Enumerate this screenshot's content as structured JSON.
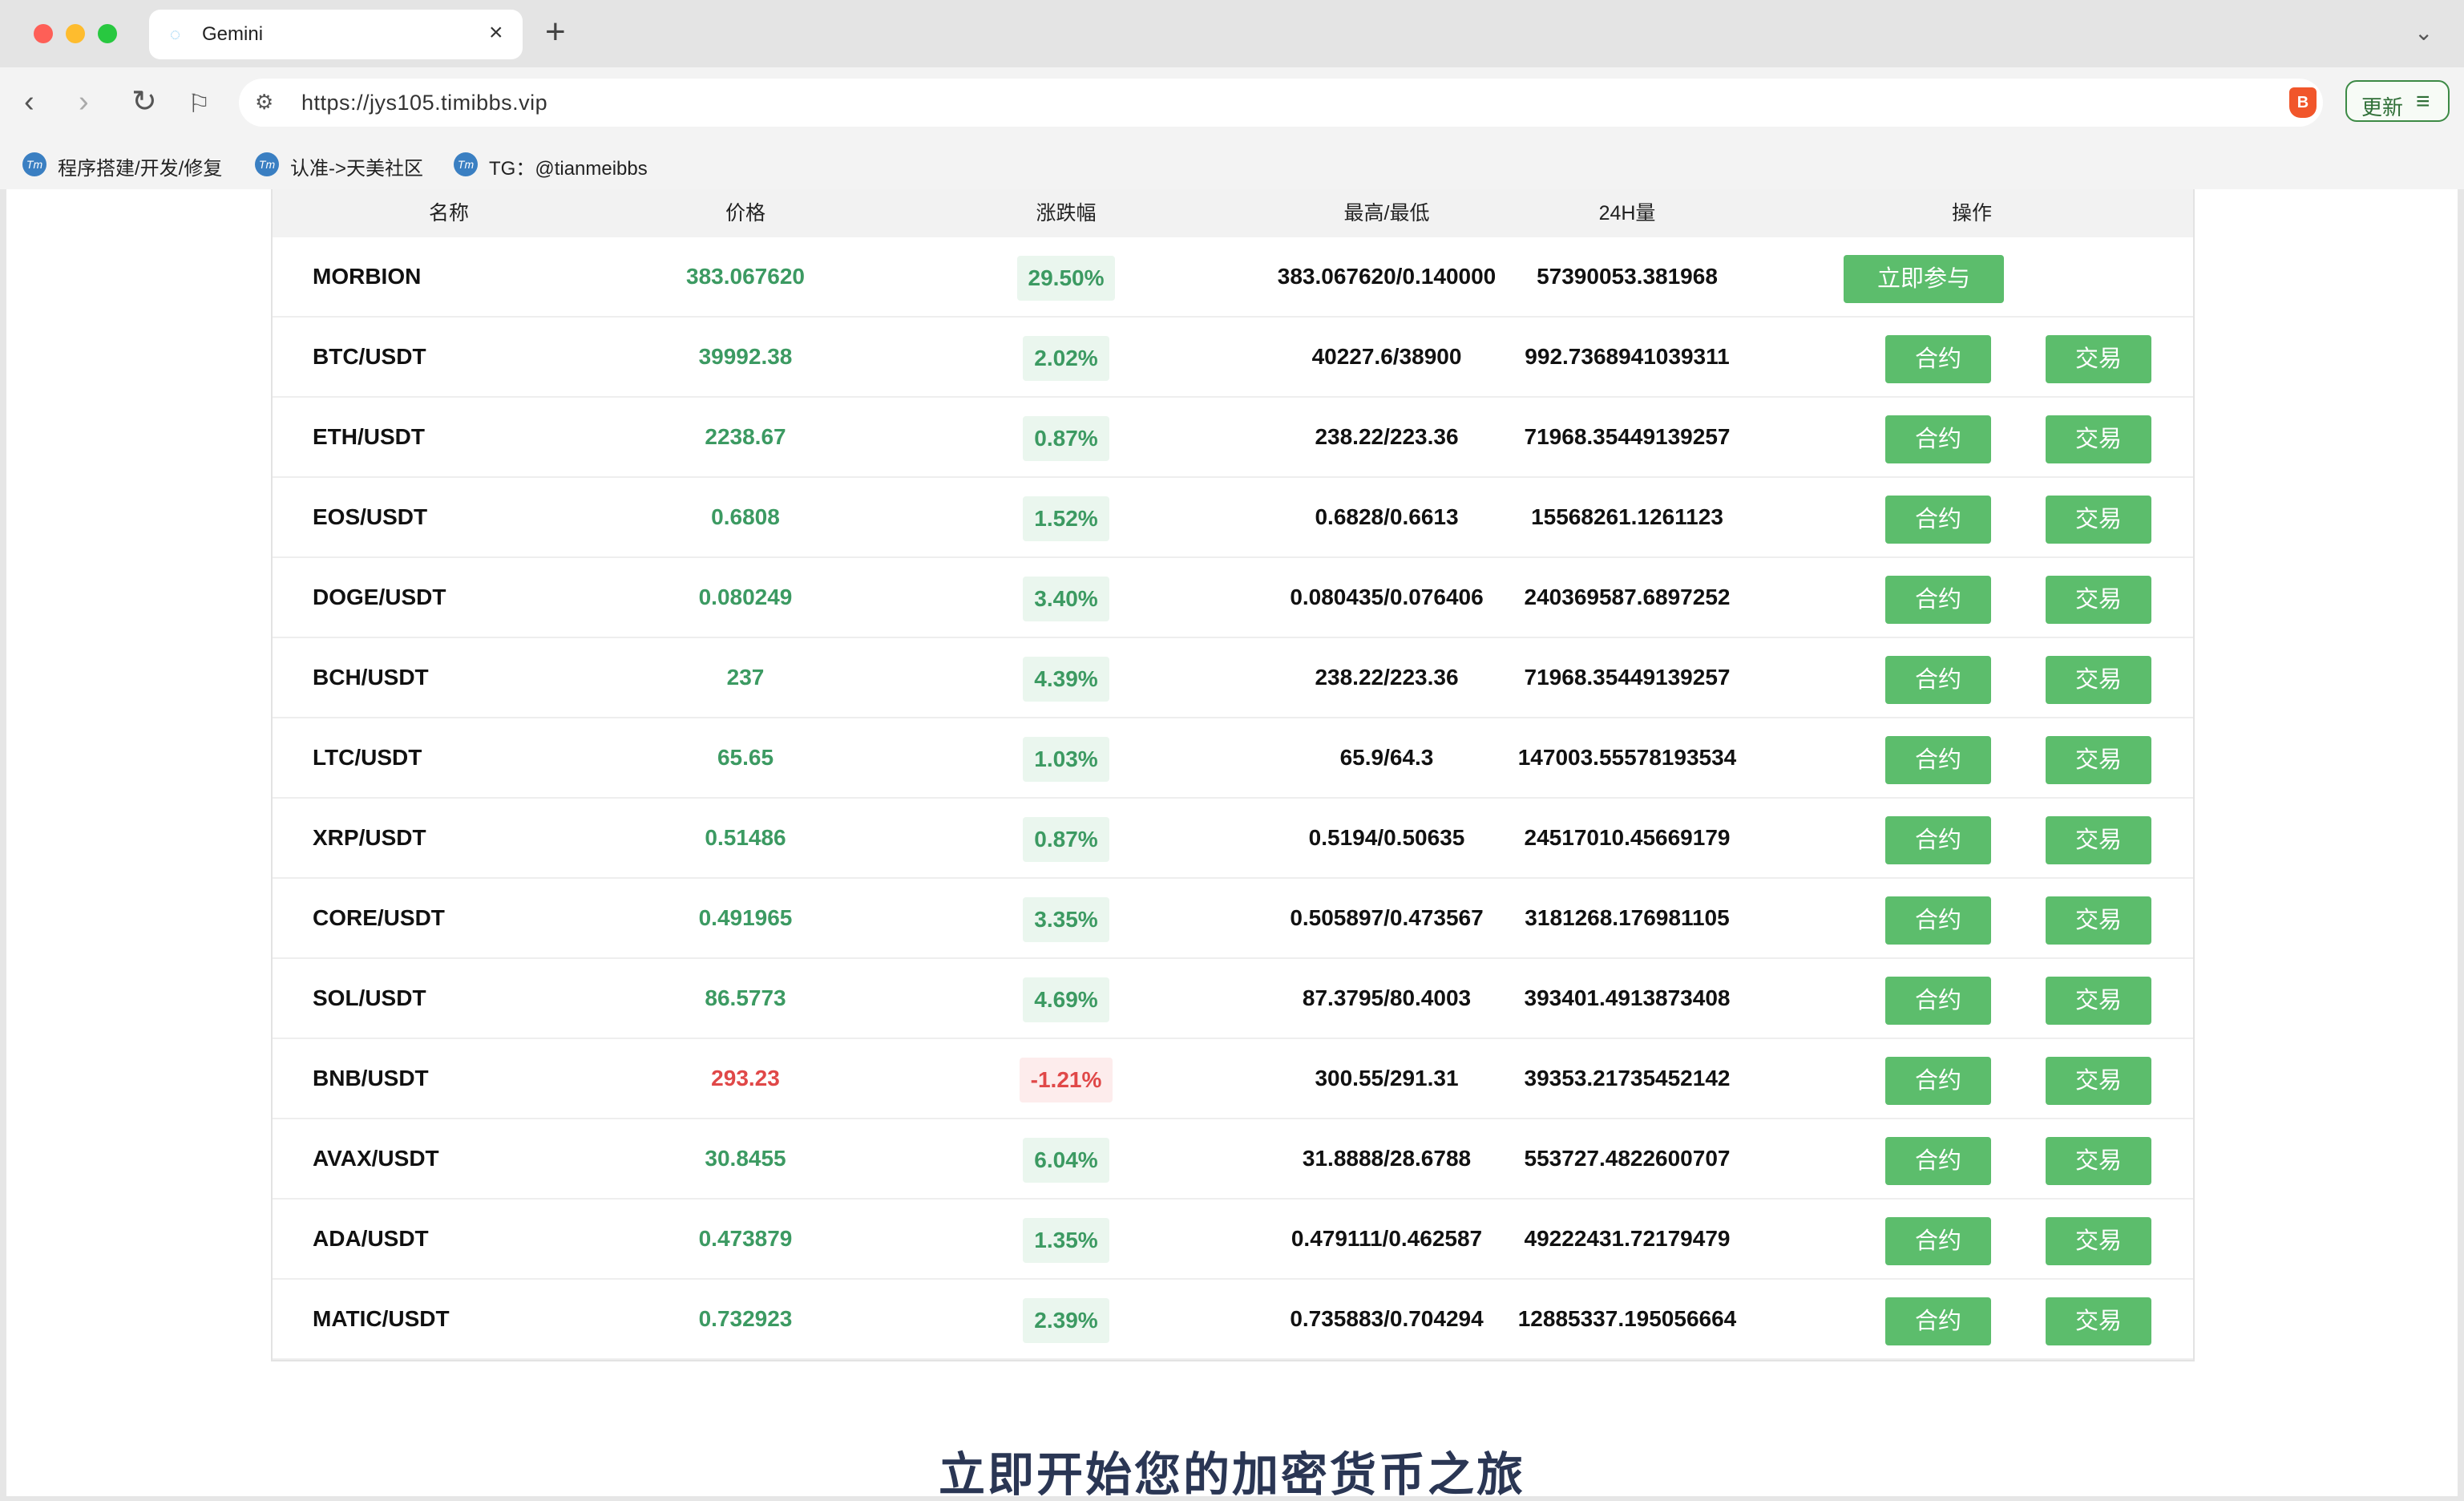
{
  "browser": {
    "tab_title": "Gemini",
    "url": "https://jys105.timibbs.vip",
    "update_label": "更新",
    "bookmarks": [
      {
        "label": "程序搭建/开发/修复"
      },
      {
        "label": "认准->天美社区"
      },
      {
        "label": "TG：@tianmeibbs"
      }
    ]
  },
  "table": {
    "headers": {
      "name": "名称",
      "price": "价格",
      "change": "涨跌幅",
      "highlow": "最高/最低",
      "volume": "24H量",
      "action": "操作"
    },
    "contract_label": "合约",
    "trade_label": "交易",
    "join_label": "立即参与",
    "rows": [
      {
        "name": "MORBION",
        "price": "383.067620",
        "change": "29.50%",
        "highlow": "383.067620/0.140000",
        "volume": "57390053.381968",
        "direction": "up"
      },
      {
        "name": "BTC/USDT",
        "price": "39992.38",
        "change": "2.02%",
        "highlow": "40227.6/38900",
        "volume": "992.7368941039311",
        "direction": "up"
      },
      {
        "name": "ETH/USDT",
        "price": "2238.67",
        "change": "0.87%",
        "highlow": "238.22/223.36",
        "volume": "71968.35449139257",
        "direction": "up"
      },
      {
        "name": "EOS/USDT",
        "price": "0.6808",
        "change": "1.52%",
        "highlow": "0.6828/0.6613",
        "volume": "15568261.1261123",
        "direction": "up"
      },
      {
        "name": "DOGE/USDT",
        "price": "0.080249",
        "change": "3.40%",
        "highlow": "0.080435/0.076406",
        "volume": "240369587.6897252",
        "direction": "up"
      },
      {
        "name": "BCH/USDT",
        "price": "237",
        "change": "4.39%",
        "highlow": "238.22/223.36",
        "volume": "71968.35449139257",
        "direction": "up"
      },
      {
        "name": "LTC/USDT",
        "price": "65.65",
        "change": "1.03%",
        "highlow": "65.9/64.3",
        "volume": "147003.55578193534",
        "direction": "up"
      },
      {
        "name": "XRP/USDT",
        "price": "0.51486",
        "change": "0.87%",
        "highlow": "0.5194/0.50635",
        "volume": "24517010.45669179",
        "direction": "up"
      },
      {
        "name": "CORE/USDT",
        "price": "0.491965",
        "change": "3.35%",
        "highlow": "0.505897/0.473567",
        "volume": "3181268.176981105",
        "direction": "up"
      },
      {
        "name": "SOL/USDT",
        "price": "86.5773",
        "change": "4.69%",
        "highlow": "87.3795/80.4003",
        "volume": "393401.4913873408",
        "direction": "up"
      },
      {
        "name": "BNB/USDT",
        "price": "293.23",
        "change": "-1.21%",
        "highlow": "300.55/291.31",
        "volume": "39353.21735452142",
        "direction": "down"
      },
      {
        "name": "AVAX/USDT",
        "price": "30.8455",
        "change": "6.04%",
        "highlow": "31.8888/28.6788",
        "volume": "553727.4822600707",
        "direction": "up"
      },
      {
        "name": "ADA/USDT",
        "price": "0.473879",
        "change": "1.35%",
        "highlow": "0.479111/0.462587",
        "volume": "49222431.72179479",
        "direction": "up"
      },
      {
        "name": "MATIC/USDT",
        "price": "0.732923",
        "change": "2.39%",
        "highlow": "0.735883/0.704294",
        "volume": "12885337.195056664",
        "direction": "up"
      }
    ]
  },
  "cta_title": "立即开始您的加密货币之旅",
  "colors": {
    "up": "#3c9a62",
    "down": "#e04848",
    "button": "#5cbd6c",
    "heading": "#2a3654"
  }
}
